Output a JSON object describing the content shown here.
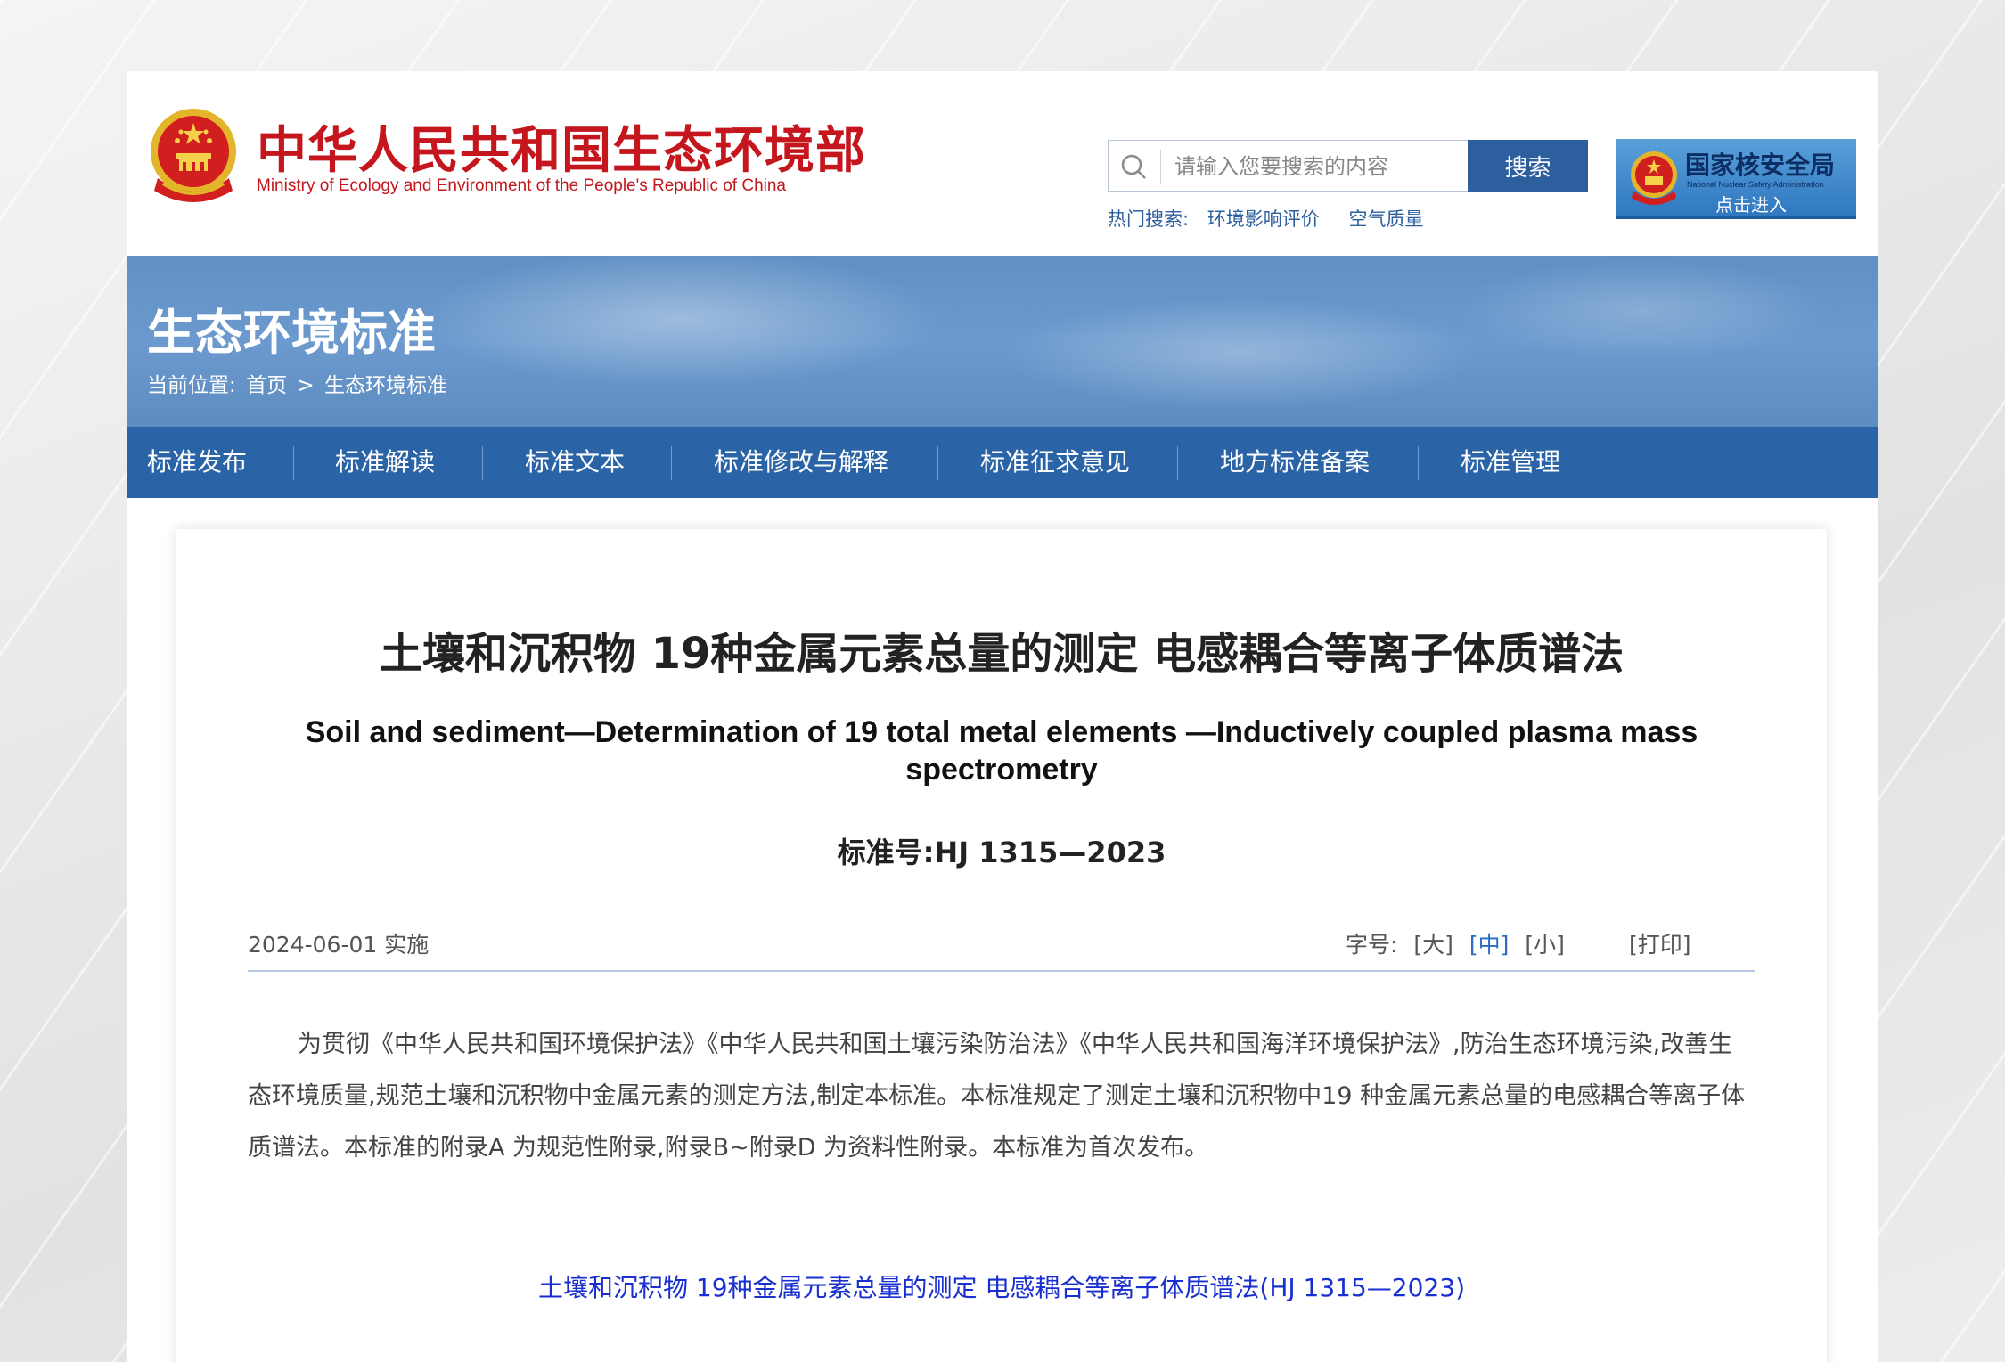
{
  "header": {
    "ministry_name_cn": "中华人民共和国生态环境部",
    "ministry_name_en": "Ministry of Ecology and Environment of the People's Republic of China",
    "search": {
      "placeholder": "请输入您要搜索的内容",
      "button_label": "搜索"
    },
    "hot_search": {
      "label": "热门搜索:",
      "items": [
        "环境影响评价",
        "空气质量"
      ]
    },
    "nnsa_banner": {
      "title": "国家核安全局",
      "subtitle_en": "National Nuclear Safety Administration",
      "enter_label": "点击进入"
    }
  },
  "banner": {
    "title": "生态环境标准",
    "breadcrumb": {
      "prefix": "当前位置:",
      "items": [
        "首页",
        "生态环境标准"
      ],
      "separator": ">"
    }
  },
  "nav": {
    "items": [
      "标准发布",
      "标准解读",
      "标准文本",
      "标准修改与解释",
      "标准征求意见",
      "地方标准备案",
      "标准管理"
    ]
  },
  "article": {
    "title_cn": "土壤和沉积物 19种金属元素总量的测定 电感耦合等离子体质谱法",
    "title_en": "Soil and sediment—Determination of 19 total metal elements —Inductively coupled plasma mass spectrometry",
    "standard_number": "标准号:HJ 1315—2023",
    "implementation_date": "2024-06-01 实施",
    "font_size": {
      "label": "字号:",
      "options": [
        "[大]",
        "[中]",
        "[小]"
      ],
      "selected": "[中]"
    },
    "print_label": "[打印]",
    "body": "为贯彻《中华人民共和国环境保护法》《中华人民共和国土壤污染防治法》《中华人民共和国海洋环境保护法》,防治生态环境污染,改善生态环境质量,规范土壤和沉积物中金属元素的测定方法,制定本标准。本标准规定了测定土壤和沉积物中19 种金属元素总量的电感耦合等离子体质谱法。本标准的附录A 为规范性附录,附录B~附录D 为资料性附录。本标准为首次发布。",
    "download_link": "土壤和沉积物 19种金属元素总量的测定 电感耦合等离子体质谱法(HJ 1315—2023)"
  },
  "colors": {
    "brand_red": "#c4161c",
    "nav_blue": "#2a64a6",
    "link_blue": "#1a2fd0",
    "search_button": "#2d5f9e"
  }
}
